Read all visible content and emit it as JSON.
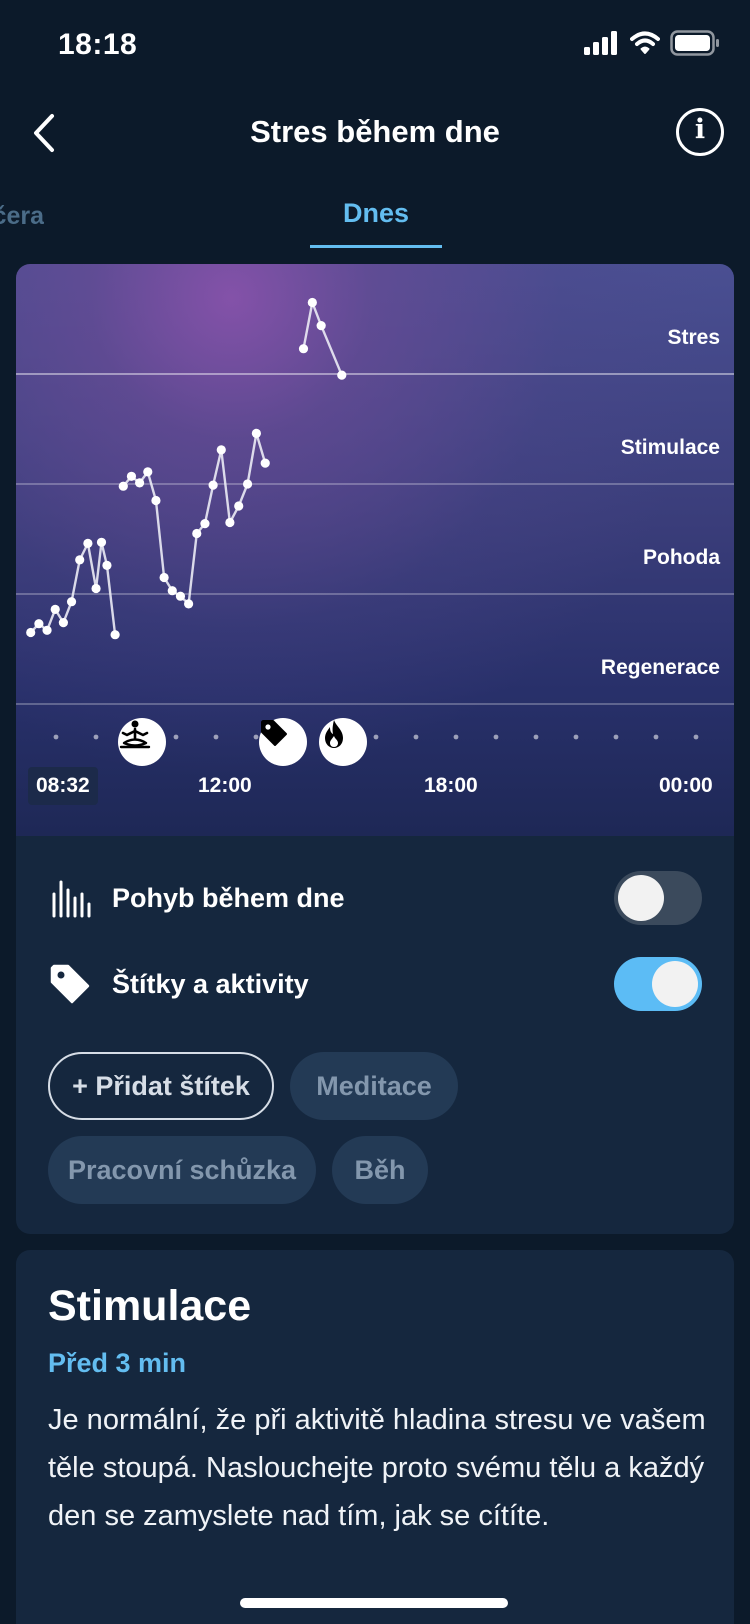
{
  "status_bar": {
    "time": "18:18"
  },
  "header": {
    "title": "Stres během dne",
    "back_icon": "chevron-left-icon",
    "info_icon": "info-icon",
    "info_glyph": "i"
  },
  "tabs": {
    "previous_partial": "Včera",
    "active": "Dnes"
  },
  "chart": {
    "zones": [
      "Stres",
      "Stimulace",
      "Pohoda",
      "Regenerace"
    ],
    "time_labels": {
      "start": "08:32",
      "t1": "12:00",
      "t2": "18:00",
      "t3": "00:00"
    },
    "markers": [
      {
        "icon": "meditation-icon",
        "label": "Meditace"
      },
      {
        "icon": "tag-icon",
        "label": "Pracovní schůzka"
      },
      {
        "icon": "flame-icon",
        "label": "Běh"
      }
    ]
  },
  "chart_data": {
    "type": "line",
    "title": "",
    "xlabel": "",
    "ylabel": "",
    "y_categories": [
      "Regenerace",
      "Pohoda",
      "Stimulace",
      "Stres"
    ],
    "ylim": [
      0,
      4
    ],
    "x_ticks": [
      "08:32",
      "12:00",
      "18:00",
      "00:00"
    ],
    "xlim": [
      "06:00",
      "00:00"
    ],
    "grid": true,
    "series": [
      {
        "points": [
          {
            "x": "06:05",
            "y": 0.65
          },
          {
            "x": "06:20",
            "y": 0.73
          },
          {
            "x": "06:35",
            "y": 0.67
          },
          {
            "x": "06:50",
            "y": 0.86
          },
          {
            "x": "07:05",
            "y": 0.74
          },
          {
            "x": "07:20",
            "y": 0.93
          },
          {
            "x": "07:35",
            "y": 1.31
          },
          {
            "x": "07:50",
            "y": 1.46
          },
          {
            "x": "08:05",
            "y": 1.05
          },
          {
            "x": "08:15",
            "y": 1.47
          },
          {
            "x": "08:25",
            "y": 1.26
          },
          {
            "x": "08:40",
            "y": 0.63
          }
        ]
      },
      {
        "points": [
          {
            "x": "08:55",
            "y": 1.98
          },
          {
            "x": "09:10",
            "y": 2.07
          },
          {
            "x": "09:25",
            "y": 2.01
          },
          {
            "x": "09:40",
            "y": 2.11
          },
          {
            "x": "09:55",
            "y": 1.85
          },
          {
            "x": "10:10",
            "y": 1.15
          },
          {
            "x": "10:25",
            "y": 1.03
          },
          {
            "x": "10:40",
            "y": 0.98
          },
          {
            "x": "10:55",
            "y": 0.91
          },
          {
            "x": "11:10",
            "y": 1.55
          },
          {
            "x": "11:25",
            "y": 1.64
          },
          {
            "x": "11:40",
            "y": 1.99
          },
          {
            "x": "11:55",
            "y": 2.31
          },
          {
            "x": "12:10",
            "y": 1.65
          },
          {
            "x": "12:25",
            "y": 1.8
          },
          {
            "x": "12:40",
            "y": 2.0
          },
          {
            "x": "12:55",
            "y": 2.46
          },
          {
            "x": "13:10",
            "y": 2.19
          }
        ]
      },
      {
        "points": [
          {
            "x": "14:15",
            "y": 3.23
          },
          {
            "x": "14:30",
            "y": 3.65
          },
          {
            "x": "14:45",
            "y": 3.44
          },
          {
            "x": "15:20",
            "y": 2.99
          }
        ]
      }
    ]
  },
  "toggles": {
    "movement": {
      "label": "Pohyb během dne",
      "icon": "activity-bars-icon",
      "state": "off"
    },
    "tags": {
      "label": "Štítky a aktivity",
      "icon": "tag-icon",
      "state": "on"
    }
  },
  "chips": {
    "add": "+ Přidat štítek",
    "items": [
      "Meditace",
      "Pracovní schůzka",
      "Běh"
    ]
  },
  "info_card": {
    "title": "Stimulace",
    "time_ago": "Před 3 min",
    "text": "Je normální, že při aktivitě hladina stresu ve vašem těle stoupá. Naslouchejte proto svému tělu a každý den se zamyslete nad tím, jak se cítíte."
  },
  "colors": {
    "background": "#0c1a2a",
    "accent": "#63bdf0",
    "toggle_on": "#5cbcf5",
    "card": "#15273e",
    "chip": "#233a55"
  }
}
